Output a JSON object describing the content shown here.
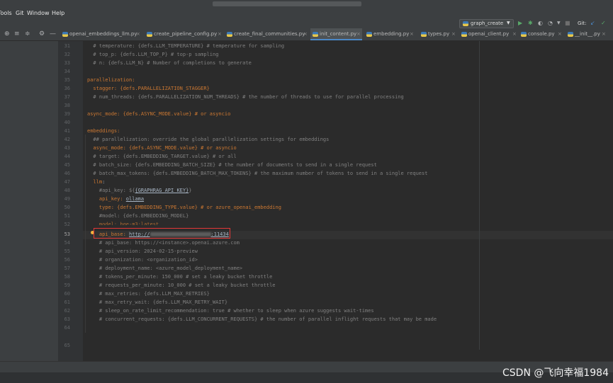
{
  "menubar": {
    "items": [
      "Tools",
      "Git",
      "Window",
      "Help"
    ]
  },
  "toolbar": {
    "run_config": "graph_create",
    "git_label": "Git:",
    "icons": [
      "run-icon",
      "debug-icon",
      "coverage-icon",
      "profile-icon",
      "stop-icon",
      "git-update-icon",
      "git-commit-icon"
    ]
  },
  "tabs": [
    {
      "name": "openai_embeddings_llm.py",
      "active": false
    },
    {
      "name": "create_pipeline_config.py",
      "active": false
    },
    {
      "name": "create_final_communities.py",
      "active": false
    },
    {
      "name": "init_content.py",
      "active": true
    },
    {
      "name": "embedding.py",
      "active": false
    },
    {
      "name": "types.py",
      "active": false
    },
    {
      "name": "openai_client.py",
      "active": false
    },
    {
      "name": "console.py",
      "active": false
    },
    {
      "name": "__init__.py",
      "active": false
    }
  ],
  "editor": {
    "current_line": 52,
    "line_numbers": [
      "31",
      "32",
      "33",
      "34",
      "35",
      "36",
      "37",
      "38",
      "39",
      "40",
      "41",
      "42",
      "43",
      "44",
      "45",
      "46",
      "47",
      "48",
      "49",
      "50",
      "51",
      "52",
      "53",
      "54",
      "55",
      "56",
      "57",
      "58",
      "59",
      "60",
      "61",
      "62",
      "63",
      "64",
      "65"
    ]
  },
  "code": {
    "l31": "  # temperature: {defs.LLM_TEMPERATURE} # temperature for sampling",
    "l32": "  # top_p: {defs.LLM_TOP_P} # top-p sampling",
    "l33": "  # n: {defs.LLM_N} # Number of completions to generate",
    "l35": "parallelization:",
    "l36": "  stagger: {defs.PARALLELIZATION_STAGGER}",
    "l37": "  # num_threads: {defs.PARALLELIZATION_NUM_THREADS} # the number of threads to use for parallel processing",
    "l39": "async_mode: {defs.ASYNC_MODE.value} # or asyncio",
    "l41": "embeddings:",
    "l42": "  ## parallelization: override the global parallelization settings for embeddings",
    "l43": "  async_mode: {defs.ASYNC_MODE.value} # or asyncio",
    "l44": "  # target: {defs.EMBEDDING_TARGET.value} # or all",
    "l45": "  # batch_size: {defs.EMBEDDING_BATCH_SIZE} # the number of documents to send in a single request",
    "l46": "  # batch_max_tokens: {defs.EMBEDDING_BATCH_MAX_TOKENS} # the maximum number of tokens to send in a single request",
    "l47_key": "  llm",
    "l48_pre": "    #api_key: ${",
    "l48_var": "{GRAPHRAG_API_KEY}",
    "l48_post": "}",
    "l49_key": "    api_key: ",
    "l49_val": "ollama",
    "l50": "    type: {defs.EMBEDDING_TYPE.value} # or azure_openai_embedding",
    "l51": "    #model: {defs.EMBEDDING_MODEL}",
    "l52_partial": "    model: bge-m3:latest",
    "l53_key": "    api_base: ",
    "l53_val_start": "http://",
    "l53_val_end": ":11434",
    "l54": "    # api_base: https://<instance>.openai.azure.com",
    "l55": "    # api_version: 2024-02-15-preview",
    "l56": "    # organization: <organization_id>",
    "l57": "    # deployment_name: <azure_model_deployment_name>",
    "l58": "    # tokens_per_minute: 150_000 # set a leaky bucket throttle",
    "l59": "    # requests_per_minute: 10_000 # set a leaky bucket throttle",
    "l60": "    # max_retries: {defs.LLM_MAX_RETRIES}",
    "l61": "    # max_retry_wait: {defs.LLM_MAX_RETRY_WAIT}",
    "l62": "    # sleep_on_rate_limit_recommendation: true # whether to sleep when azure suggests wait-times",
    "l63": "    # concurrent_requests: {defs.LLM_CONCURRENT_REQUESTS} # the number of parallel inflight requests that may be made"
  },
  "watermark": "CSDN @飞向幸福1984",
  "colors": {
    "editor_bg": "#2b2b2b",
    "panel_bg": "#3c3f41",
    "comment": "#808080",
    "keyword": "#cc7832",
    "text": "#a9b7c6",
    "highlight_box": "#e23838"
  }
}
